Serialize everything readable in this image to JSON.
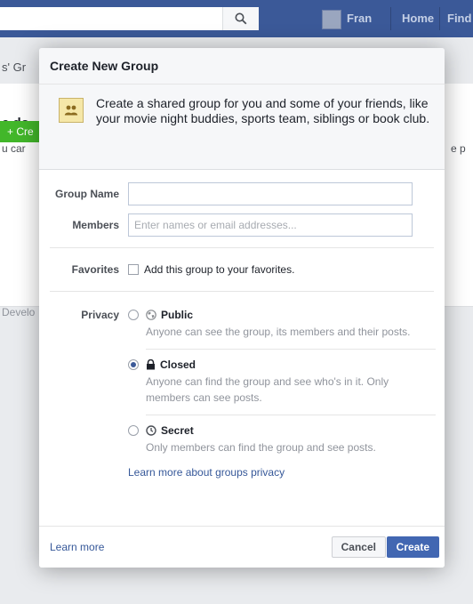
{
  "topbar": {
    "user_name": "Fran",
    "home_label": "Home",
    "find_label": "Find"
  },
  "background": {
    "breadcrumb_fragment": "s' Gr",
    "heading_fragment": "e do",
    "text_fragment": "u car",
    "text_fragment_right": "e p",
    "button_fragment": "+ Cre",
    "footer_fragment": "Develo"
  },
  "dialog": {
    "title": "Create New Group",
    "intro_text": "Create a shared group for you and some of your friends, like your movie night buddies, sports team, siblings or book club.",
    "group_name": {
      "label": "Group Name",
      "value": ""
    },
    "members": {
      "label": "Members",
      "placeholder": "Enter names or email addresses..."
    },
    "favorites": {
      "label": "Favorites",
      "checkbox_label": "Add this group to your favorites.",
      "checked": false
    },
    "privacy": {
      "label": "Privacy",
      "selected": "closed",
      "options": [
        {
          "id": "public",
          "title": "Public",
          "icon": "globe-icon",
          "desc": "Anyone can see the group, its members and their posts."
        },
        {
          "id": "closed",
          "title": "Closed",
          "icon": "lock-icon",
          "desc": "Anyone can find the group and see who's in it. Only members can see posts."
        },
        {
          "id": "secret",
          "title": "Secret",
          "icon": "secret-icon",
          "desc": "Only members can find the group and see posts."
        }
      ],
      "learn_more_link": "Learn more about groups privacy"
    },
    "footer": {
      "learn_more": "Learn more",
      "cancel": "Cancel",
      "create": "Create"
    }
  },
  "colors": {
    "topbar": "#3b5998",
    "primary_button": "#4267b2",
    "link": "#365899"
  }
}
